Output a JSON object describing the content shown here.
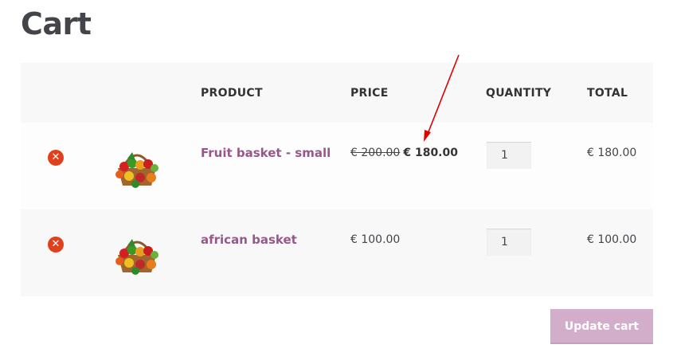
{
  "page": {
    "title": "Cart"
  },
  "table": {
    "headers": {
      "product": "PRODUCT",
      "price": "PRICE",
      "quantity": "QUANTITY",
      "total": "TOTAL"
    },
    "rows": [
      {
        "remove_icon": "remove-circle-icon",
        "remove_glyph": "✕",
        "name": "Fruit basket - small",
        "price_regular": "€ 200.00",
        "price_sale": "€ 180.00",
        "quantity": "1",
        "total": "€ 180.00"
      },
      {
        "remove_icon": "remove-circle-icon",
        "remove_glyph": "✕",
        "name": "african basket",
        "price": "€ 100.00",
        "quantity": "1",
        "total": "€ 100.00"
      }
    ]
  },
  "actions": {
    "update_label": "Update cart"
  },
  "colors": {
    "link": "#96588a",
    "remove": "#e2401c",
    "update_button": "#d3aecb",
    "annotation_arrow": "#e00000"
  }
}
